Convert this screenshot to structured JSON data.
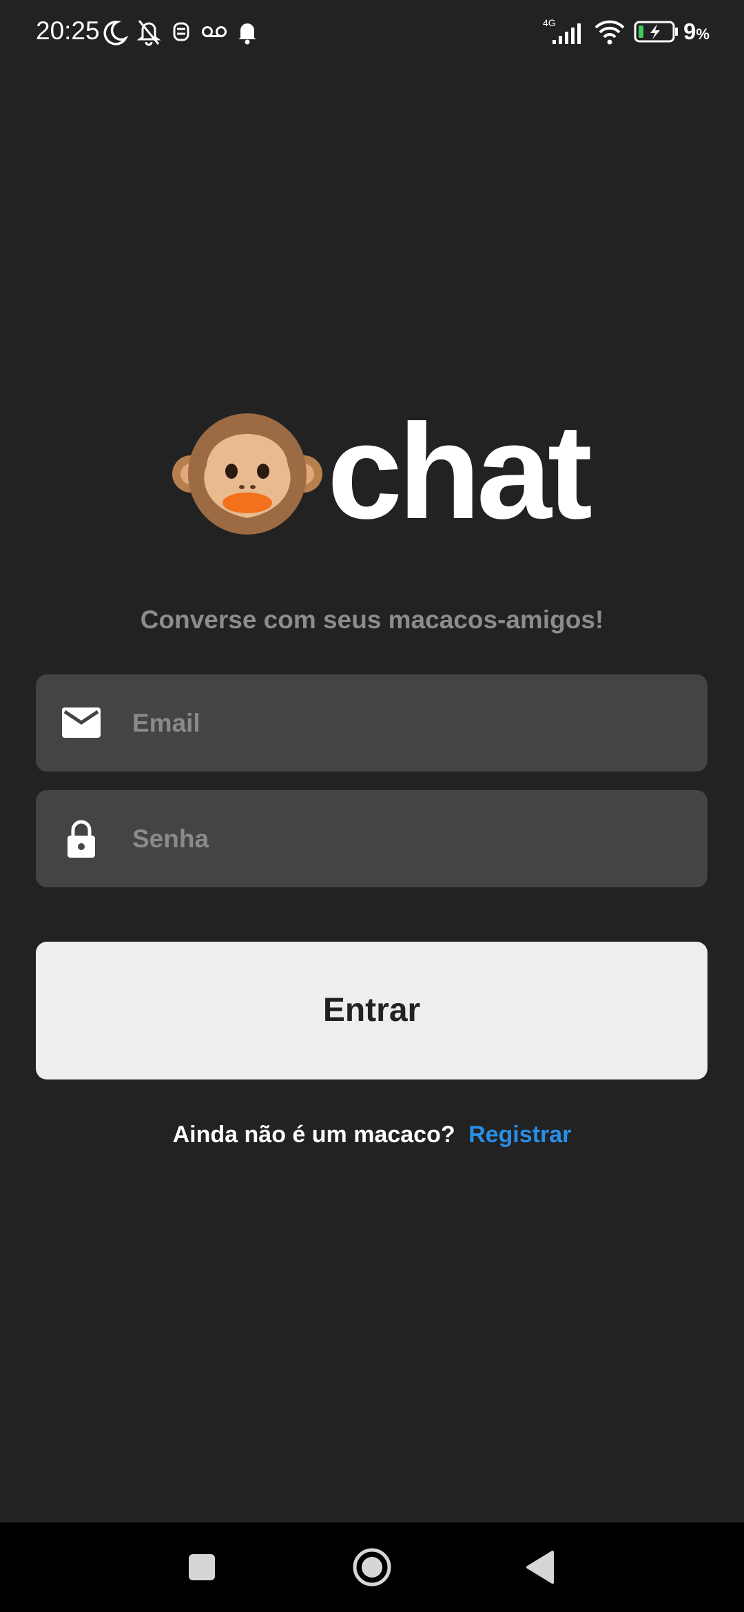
{
  "status_bar": {
    "time": "20:25",
    "network_label": "4G",
    "battery_value": "9",
    "battery_unit": "%",
    "icons": [
      "moon-icon",
      "bell-off-icon",
      "privacy-icon",
      "voicemail-icon",
      "notification-bell-icon",
      "cellular-signal-icon",
      "wifi-icon",
      "battery-charging-icon"
    ]
  },
  "logo": {
    "emoji_icon": "monkey-face-icon",
    "text": "chat"
  },
  "subtitle": "Converse com seus macacos-amigos!",
  "form": {
    "email": {
      "icon": "mail-icon",
      "placeholder": "Email",
      "value": ""
    },
    "password": {
      "icon": "lock-icon",
      "placeholder": "Senha",
      "value": ""
    },
    "submit_label": "Entrar"
  },
  "register": {
    "question": "Ainda não é um macaco?",
    "link_label": "Registrar"
  },
  "navigation_bar": {
    "buttons": [
      "recents-square-icon",
      "home-circle-icon",
      "back-triangle-icon"
    ]
  },
  "colors": {
    "background": "#222222",
    "field_background": "#444444",
    "button_background": "#eeeeee",
    "link": "#2a8ee6",
    "subtitle": "#8c8c8c"
  }
}
